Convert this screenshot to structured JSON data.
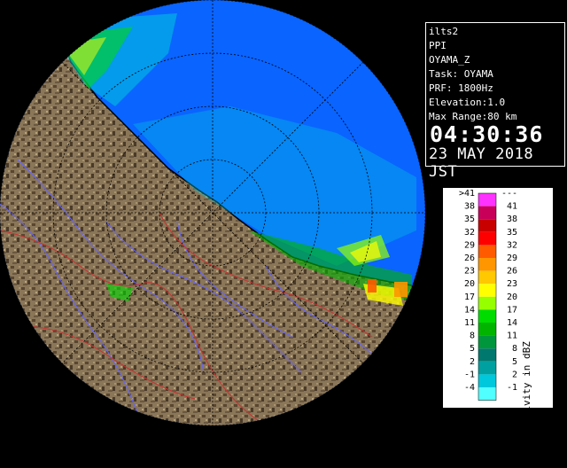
{
  "info": {
    "radar_id": "ilts2",
    "scan_mode": "PPI",
    "product": "OYAMA_Z",
    "task": "Task: OYAMA",
    "prf": "PRF: 1800Hz",
    "elevation": "Elevation:1.0",
    "max_range": "Max Range:80 km",
    "time": "04:30:36",
    "date": "23 MAY 2018 JST"
  },
  "legend": {
    "title": "Reflectivity in dBZ",
    "levels": [
      {
        "lower": "41",
        "lower_display": ">41",
        "upper": "---",
        "color": "#ff33ff"
      },
      {
        "lower": "38",
        "lower_display": "38",
        "upper": "41",
        "color": "#c8005a"
      },
      {
        "lower": "35",
        "lower_display": "35",
        "upper": "38",
        "color": "#c80000"
      },
      {
        "lower": "32",
        "lower_display": "32",
        "upper": "35",
        "color": "#ff0000"
      },
      {
        "lower": "29",
        "lower_display": "29",
        "upper": "32",
        "color": "#ff5a00"
      },
      {
        "lower": "26",
        "lower_display": "26",
        "upper": "29",
        "color": "#ff9600"
      },
      {
        "lower": "23",
        "lower_display": "23",
        "upper": "26",
        "color": "#ffc800"
      },
      {
        "lower": "20",
        "lower_display": "20",
        "upper": "23",
        "color": "#ffff00"
      },
      {
        "lower": "17",
        "lower_display": "17",
        "upper": "20",
        "color": "#96ff00"
      },
      {
        "lower": "14",
        "lower_display": "14",
        "upper": "17",
        "color": "#00dc00"
      },
      {
        "lower": "11",
        "lower_display": "11",
        "upper": "14",
        "color": "#00b400"
      },
      {
        "lower": "8",
        "lower_display": "8",
        "upper": "11",
        "color": "#00963c"
      },
      {
        "lower": "5",
        "lower_display": "5",
        "upper": "8",
        "color": "#00786e"
      },
      {
        "lower": "2",
        "lower_display": "2",
        "upper": "5",
        "color": "#00a0a0"
      },
      {
        "lower": "-1",
        "lower_display": "-1",
        "upper": "2",
        "color": "#00c8dc"
      },
      {
        "lower": "-4",
        "lower_display": "-4",
        "upper": "-1",
        "color": "#50ffff"
      }
    ]
  },
  "colors": {
    "sea": "#0a64ff",
    "land": "#8a7658",
    "land_dark": "#5a4630",
    "range_ring": "#000000",
    "river": "#6464ff",
    "boundary": "#c83232"
  }
}
